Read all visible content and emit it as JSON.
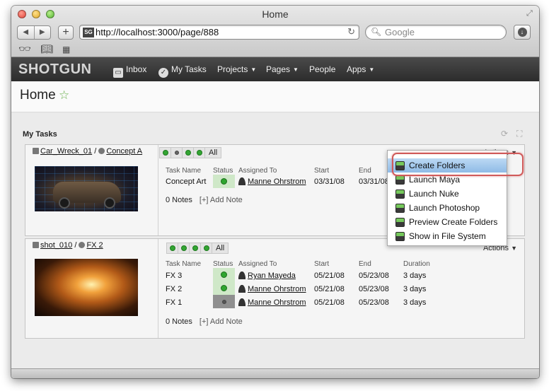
{
  "window": {
    "title": "Home"
  },
  "toolbar": {
    "url": "http://localhost:3000/page/888",
    "favicon_text": "SG",
    "search_placeholder": "Google"
  },
  "nav": {
    "logo": "SHOTGUN",
    "items": [
      {
        "label": "Inbox",
        "icon": "inbox-icon"
      },
      {
        "label": "My Tasks",
        "icon": "check-circle-icon"
      },
      {
        "label": "Projects",
        "has_menu": true
      },
      {
        "label": "Pages",
        "has_menu": true
      },
      {
        "label": "People"
      },
      {
        "label": "Apps",
        "has_menu": true
      }
    ]
  },
  "page": {
    "title": "Home"
  },
  "section": {
    "title": "My Tasks"
  },
  "columns": {
    "task_name": "Task Name",
    "status": "Status",
    "assigned_to": "Assigned To",
    "start": "Start",
    "end": "End",
    "duration": "Duration"
  },
  "filter_all_label": "All",
  "actions_label": "Actions",
  "notes_label": "0 Notes",
  "add_note_label": "[+] Add Note",
  "entities": [
    {
      "link": "Car_Wreck_01",
      "sublink": "Concept A",
      "tasks": [
        {
          "name": "Concept Art",
          "status": "green",
          "assigned": "Manne Ohrstrom",
          "start": "03/31/08",
          "end": "03/31/08",
          "duration": ""
        }
      ]
    },
    {
      "link": "shot_010",
      "sublink": "FX 2",
      "tasks": [
        {
          "name": "FX 3",
          "status": "green",
          "assigned": "Ryan Mayeda",
          "start": "05/21/08",
          "end": "05/23/08",
          "duration": "3 days"
        },
        {
          "name": "FX 2",
          "status": "green",
          "assigned": "Manne Ohrstrom",
          "start": "05/21/08",
          "end": "05/23/08",
          "duration": "3 days"
        },
        {
          "name": "FX 1",
          "status": "gray",
          "assigned": "Manne Ohrstrom",
          "start": "05/21/08",
          "end": "05/23/08",
          "duration": "3 days"
        }
      ]
    }
  ],
  "actions_menu": {
    "selected_index": 0,
    "items": [
      "Create Folders",
      "Launch Maya",
      "Launch Nuke",
      "Launch Photoshop",
      "Preview Create Folders",
      "Show in File System"
    ]
  },
  "colors": {
    "status_green": "#2fa52f",
    "status_gray": "#555555",
    "highlight_ring": "#d05a5a",
    "nav_bg": "#333333"
  }
}
